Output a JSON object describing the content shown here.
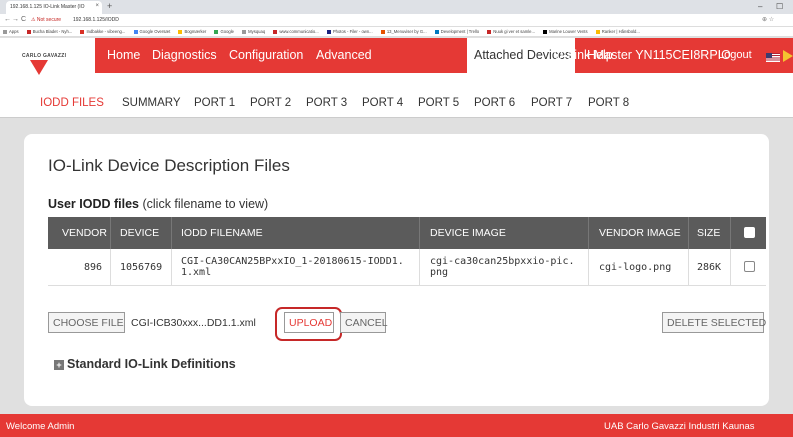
{
  "browser": {
    "tab_title": "192.168.1.125 IO-Link Master (IO",
    "tab_close": "×",
    "new_tab": "+",
    "win_min": "–",
    "win_max": "☐",
    "back": "←",
    "forward": "→",
    "reload": "C",
    "security": "⚠ Not secure",
    "url": "192.168.1.125/IODD",
    "addr_icons": "⊕ ☆",
    "bookmarks": [
      "Apps",
      "Bucha Bladet - Nyh...",
      "Indbakke - vibeeng...",
      "Google Oversæt",
      "Bogmærker",
      "Google",
      "Mysquaq",
      "www.communicatio...",
      "Photos - Filer - own...",
      "13_Menuviser by G...",
      "Development | Trello",
      "Nuuk gi ver et samle...",
      "Marine Louver Vents",
      "Ranker | Hånsbold..."
    ]
  },
  "header": {
    "logo_text": "CARLO GAVAZZI",
    "nav": [
      "Home",
      "Diagnostics",
      "Configuration",
      "Advanced",
      "Attached Devices",
      "Help"
    ],
    "master_label": "IO-Link Master YN115CEI8RPIO",
    "logout": "Logout"
  },
  "subnav": [
    "IODD FILES",
    "SUMMARY",
    "PORT 1",
    "PORT 2",
    "PORT 3",
    "PORT 4",
    "PORT 5",
    "PORT 6",
    "PORT 7",
    "PORT 8"
  ],
  "main": {
    "title": "IO-Link Device Description Files",
    "section_bold": "User IODD files",
    "section_rest": " (click filename to view)",
    "columns": [
      "VENDOR",
      "DEVICE",
      "IODD FILENAME",
      "DEVICE IMAGE",
      "VENDOR IMAGE",
      "SIZE"
    ],
    "rows": [
      {
        "vendor": "896",
        "device": "1056769",
        "filename_line1": "CGI-CA30CAN25BPxxIO_1-20180615-IODD1.",
        "filename_line2": "1.xml",
        "device_image_line1": "cgi-ca30can25bpxxio-pic.",
        "device_image_line2": "png",
        "vendor_image": "cgi-logo.png",
        "size": "286K"
      }
    ],
    "choose_file": "CHOOSE FILE",
    "selected_file": "CGI-ICB30xxx...DD1.1.xml",
    "upload": "UPLOAD",
    "cancel": "CANCEL",
    "delete_selected": "DELETE SELECTED",
    "standard_defs": "Standard IO-Link Definitions"
  },
  "footer": {
    "left": "Welcome Admin",
    "right": "UAB Carlo Gavazzi Industri Kaunas"
  },
  "colors": {
    "brand_red": "#e53935",
    "table_header": "#5b5b5b",
    "upload_highlight": "#c62828"
  }
}
